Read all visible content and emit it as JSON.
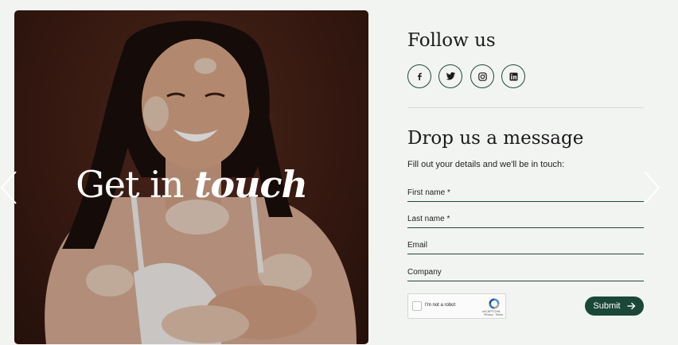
{
  "hero": {
    "title_main": "Get in ",
    "title_emphasis": "touch"
  },
  "follow": {
    "title": "Follow us",
    "socials": [
      {
        "icon": "facebook-icon"
      },
      {
        "icon": "twitter-icon"
      },
      {
        "icon": "instagram-icon"
      },
      {
        "icon": "linkedin-icon"
      }
    ]
  },
  "message": {
    "title": "Drop us a message",
    "subtitle": "Fill out your details and we'll be in touch:"
  },
  "form": {
    "first_name_placeholder": "First name *",
    "last_name_placeholder": "Last name *",
    "email_placeholder": "Email",
    "company_placeholder": "Company",
    "captcha_label": "I'm not a robot",
    "captcha_brand": "reCAPTCHA",
    "captcha_links": "Privacy - Terms",
    "submit_label": "Submit"
  },
  "colors": {
    "background": "#f2f4f2",
    "accent": "#1a4738",
    "hero_bg": "#3f1d14"
  }
}
